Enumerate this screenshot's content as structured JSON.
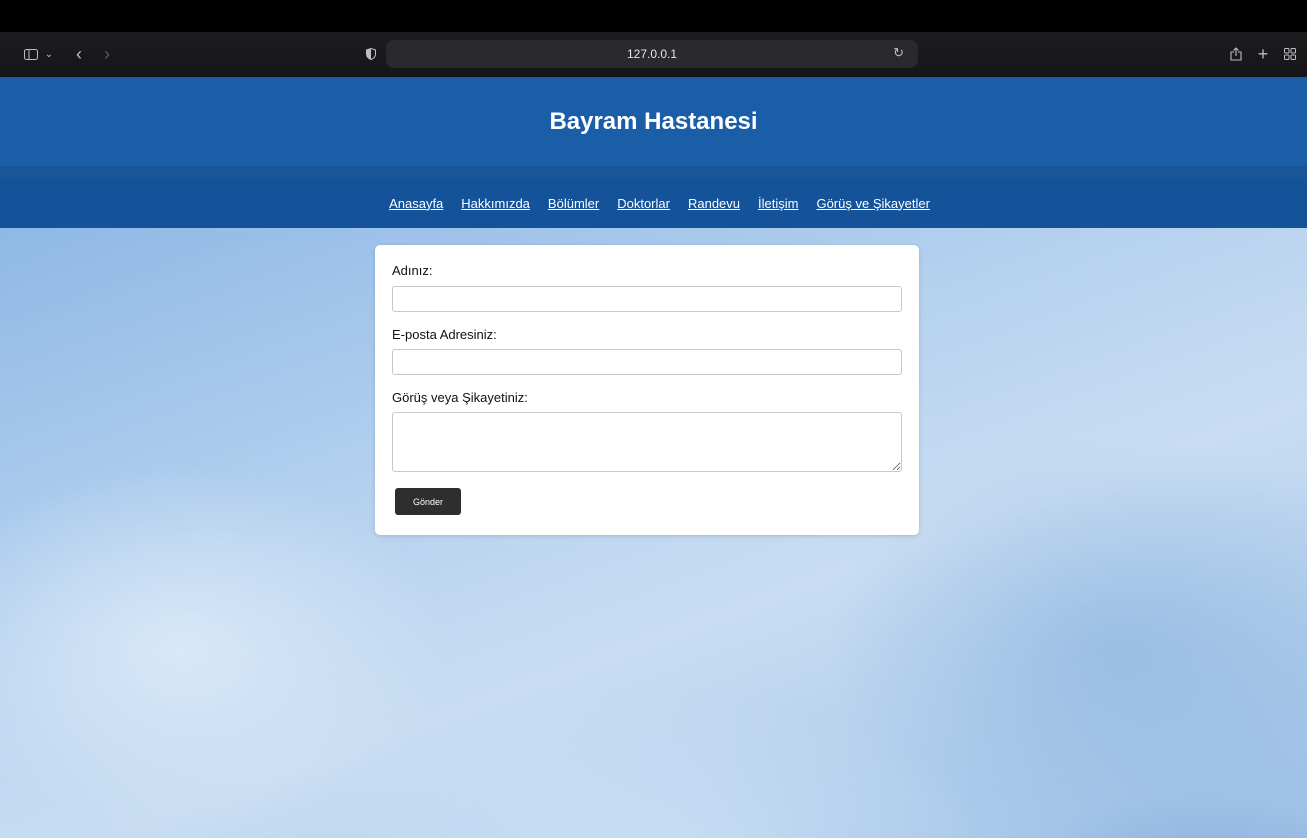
{
  "browser": {
    "url": "127.0.0.1",
    "icons": {
      "sidebar": "sidebar-icon",
      "chevron": "chevron-down-icon",
      "back": "back-arrow-icon",
      "forward": "forward-arrow-icon",
      "shield": "privacy-shield-icon",
      "reload": "reload-icon",
      "share": "share-icon",
      "new_tab": "plus-icon",
      "tab_overview": "tab-grid-icon"
    }
  },
  "site": {
    "title": "Bayram Hastanesi",
    "nav": [
      {
        "label": "Anasayfa"
      },
      {
        "label": "Hakkımızda"
      },
      {
        "label": "Bölümler"
      },
      {
        "label": "Doktorlar"
      },
      {
        "label": "Randevu"
      },
      {
        "label": "İletişim"
      },
      {
        "label": "Görüş ve Şikayetler"
      }
    ],
    "colors": {
      "header": "#1a5ea8",
      "nav": "#14529a",
      "button": "#2e2e2e"
    }
  },
  "form": {
    "name_label": "Adınız:",
    "name_value": "",
    "email_label": "E-posta Adresiniz:",
    "email_value": "",
    "message_label": "Görüş veya Şikayetiniz:",
    "message_value": "",
    "submit_label": "Gönder"
  }
}
